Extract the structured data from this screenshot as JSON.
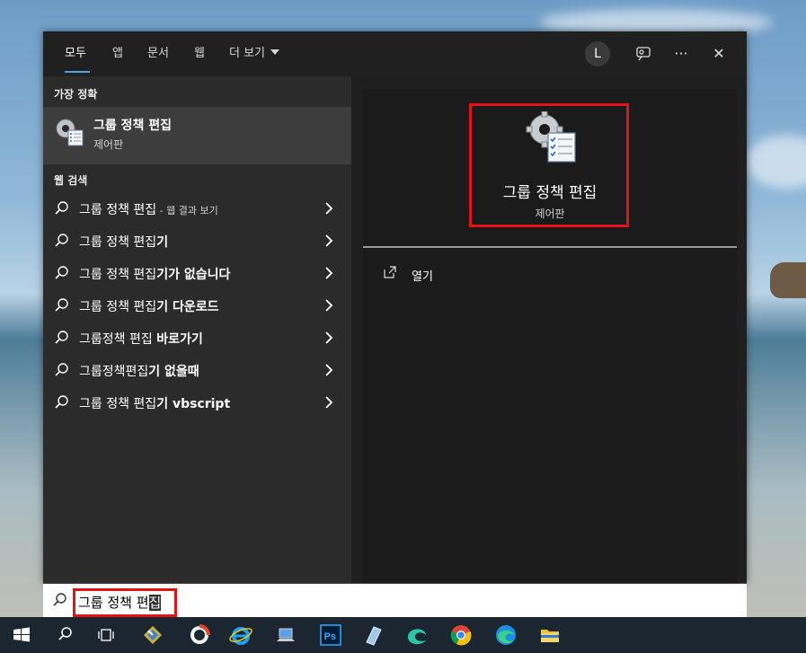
{
  "tabs": [
    {
      "label": "모두",
      "active": true
    },
    {
      "label": "앱"
    },
    {
      "label": "문서"
    },
    {
      "label": "웹"
    },
    {
      "label": "더 보기"
    }
  ],
  "header": {
    "avatar_initial": "L",
    "feedback_icon": "feedback-icon",
    "more_glyph": "···",
    "close_glyph": "✕"
  },
  "left": {
    "best_match_header": "가장 정확",
    "best_match": {
      "title": "그룹 정책 편집",
      "subtitle": "제어판"
    },
    "web_header": "웹 검색",
    "web_results": [
      {
        "prefix": "그룹 정책 편집",
        "bold": "",
        "suffix": " - 웹 결과 보기"
      },
      {
        "prefix": "그룹 정책 편집",
        "bold": "기",
        "suffix": ""
      },
      {
        "prefix": "그룹 정책 편집",
        "bold": "기가 없습니다",
        "suffix": ""
      },
      {
        "prefix": "그룹 정책 편집",
        "bold": "기 다운로드",
        "suffix": ""
      },
      {
        "prefix": "그룹정책 편집 ",
        "bold": "바로가기",
        "suffix": ""
      },
      {
        "prefix": "그룹정책편집",
        "bold": "기 없을때",
        "suffix": ""
      },
      {
        "prefix": "그룹 정책 편집",
        "bold": "기 vbscript",
        "suffix": ""
      }
    ]
  },
  "preview": {
    "title": "그룹 정책 편집",
    "subtitle": "제어판",
    "actions": [
      {
        "label": "열기",
        "icon": "open-icon"
      }
    ]
  },
  "search": {
    "text_before": "그룹 정책 편",
    "text_selected": "집"
  },
  "taskbar": {
    "icons": [
      "windows-start-icon",
      "search-icon",
      "task-view-icon",
      "app-icon",
      "recorder-icon",
      "internet-explorer-icon",
      "computer-icon",
      "photoshop-icon",
      "notepad-icon",
      "edge-legacy-icon",
      "chrome-icon",
      "edge-icon",
      "file-explorer-icon"
    ]
  },
  "colors": {
    "accent": "#4ea1ea",
    "highlight_box": "#e01414",
    "panel_bg": "#1f1f1f",
    "left_bg": "#2b2b2b"
  }
}
